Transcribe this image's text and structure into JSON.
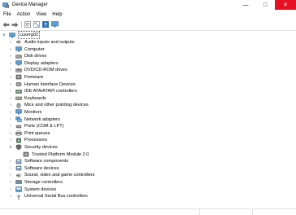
{
  "window": {
    "title": "Device Manager",
    "controls": [
      "minimize",
      "maximize",
      "close"
    ]
  },
  "menu": [
    "File",
    "Action",
    "View",
    "Help"
  ],
  "toolbar": [
    "back-arrow-icon",
    "forward-arrow-icon",
    "properties-icon",
    "show-hidden-icon",
    "help-icon",
    "monitor-icon"
  ],
  "tree": {
    "root": "cuserg02",
    "categories": [
      {
        "label": "Audio inputs and outputs",
        "icon": "audio-icon",
        "expanded": false
      },
      {
        "label": "Computer",
        "icon": "computer-icon",
        "expanded": false
      },
      {
        "label": "Disk drives",
        "icon": "disk-icon",
        "expanded": false
      },
      {
        "label": "Display adapters",
        "icon": "display-icon",
        "expanded": false
      },
      {
        "label": "DVD/CD-ROM drives",
        "icon": "dvd-icon",
        "expanded": false
      },
      {
        "label": "Firmware",
        "icon": "firmware-icon",
        "expanded": false
      },
      {
        "label": "Human Interface Devices",
        "icon": "hid-icon",
        "expanded": false
      },
      {
        "label": "IDE ATA/ATAPI controllers",
        "icon": "ide-icon",
        "expanded": false
      },
      {
        "label": "Keyboards",
        "icon": "keyboard-icon",
        "expanded": false
      },
      {
        "label": "Mice and other pointing devices",
        "icon": "mouse-icon",
        "expanded": false
      },
      {
        "label": "Monitors",
        "icon": "monitor-icon",
        "expanded": false
      },
      {
        "label": "Network adapters",
        "icon": "network-icon",
        "expanded": false
      },
      {
        "label": "Ports (COM & LPT)",
        "icon": "port-icon",
        "expanded": false
      },
      {
        "label": "Print queues",
        "icon": "printer-icon",
        "expanded": false
      },
      {
        "label": "Processors",
        "icon": "processor-icon",
        "expanded": false
      },
      {
        "label": "Security devices",
        "icon": "security-icon",
        "expanded": true,
        "children": [
          "Trusted Platform Module 2.0"
        ]
      },
      {
        "label": "Software components",
        "icon": "software-icon",
        "expanded": false
      },
      {
        "label": "Software devices",
        "icon": "software-icon",
        "expanded": false
      },
      {
        "label": "Sound, video and game controllers",
        "icon": "sound-icon",
        "expanded": false
      },
      {
        "label": "Storage controllers",
        "icon": "storage-icon",
        "expanded": false
      },
      {
        "label": "System devices",
        "icon": "system-icon",
        "expanded": false
      },
      {
        "label": "Universal Serial Bus controllers",
        "icon": "usb-icon",
        "expanded": false
      }
    ]
  },
  "colors": {
    "close": "#e81123",
    "accent": "#0078d7"
  }
}
